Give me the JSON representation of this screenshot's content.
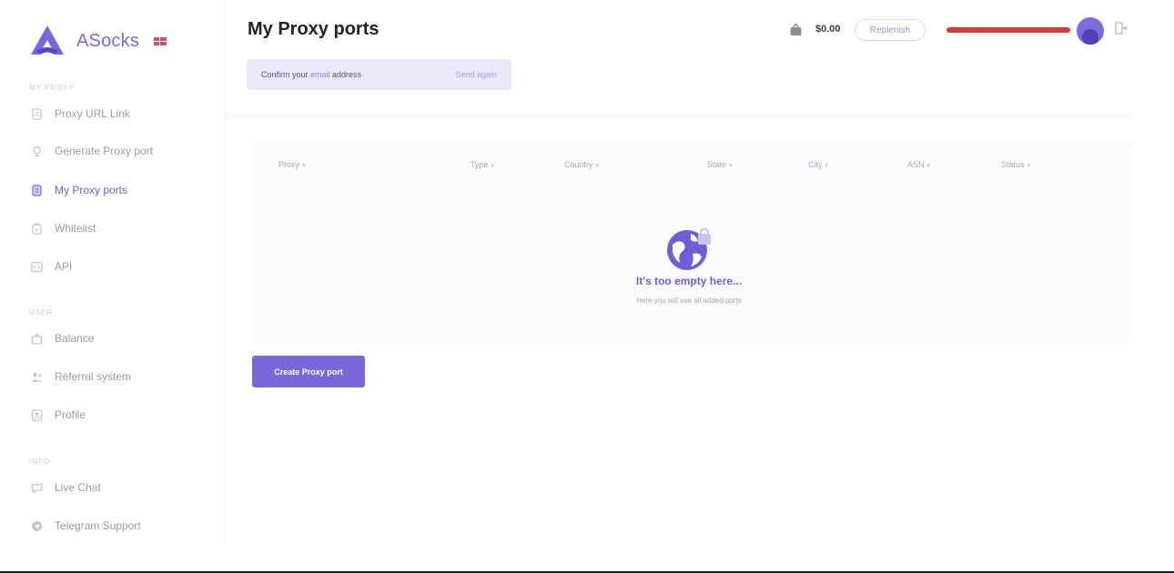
{
  "brand": {
    "name": "ASocks"
  },
  "sidebar": {
    "sections": {
      "my_proxy": "MY PROXY",
      "user": "USER",
      "info": "INFO"
    },
    "items": [
      {
        "label": "Proxy URL Link",
        "icon": "link-icon"
      },
      {
        "label": "Generate Proxy port",
        "icon": "plug-icon"
      },
      {
        "label": "My Proxy ports",
        "icon": "server-icon",
        "active": true
      },
      {
        "label": "Whitelist",
        "icon": "clipboard-icon"
      },
      {
        "label": "API",
        "icon": "code-icon"
      },
      {
        "label": "Balance",
        "icon": "wallet-icon"
      },
      {
        "label": "Referral system",
        "icon": "users-icon"
      },
      {
        "label": "Profile",
        "icon": "profile-icon"
      },
      {
        "label": "Live Chat",
        "icon": "chat-icon"
      },
      {
        "label": "Telegram Support",
        "icon": "telegram-icon"
      }
    ]
  },
  "header": {
    "title": "My Proxy ports",
    "balance": "$0.00",
    "replenish_label": "Replenish"
  },
  "banner": {
    "text_before": "Confirm your ",
    "text_link": "email",
    "text_after": " address",
    "action": "Send again"
  },
  "table": {
    "columns": [
      "Proxy",
      "Type",
      "Country",
      "State",
      "City",
      "ASN",
      "Status"
    ]
  },
  "empty_state": {
    "title": "It's too empty here...",
    "subtitle": "Here you will see all added ports"
  },
  "create_button": "Create Proxy port",
  "colors": {
    "accent": "#7a67d9",
    "accent_text": "#6d5fd0",
    "banner_bg": "#ebe8fb"
  }
}
